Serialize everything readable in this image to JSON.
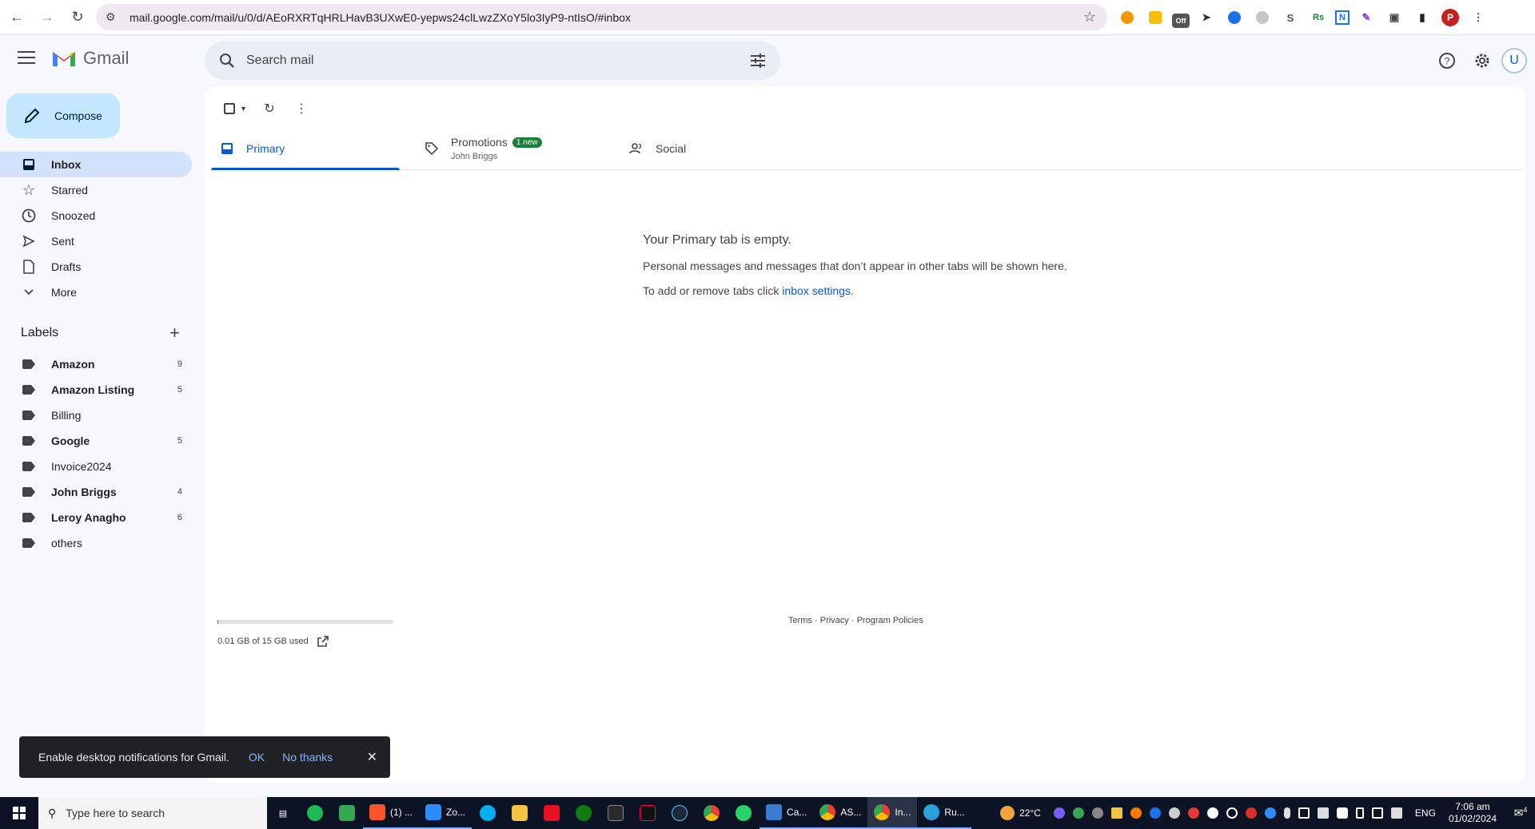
{
  "browser": {
    "url": "mail.google.com/mail/u/0/d/AEoRXRTqHRLHavB3UXwE0-yepws24clLwzZXoY5lo3IyP9-ntIsO/#inbox",
    "extension_badge": "Off",
    "profile_initial": "P"
  },
  "header": {
    "logo_text": "Gmail",
    "search_placeholder": "Search mail",
    "avatar_initial": "U"
  },
  "sidebar": {
    "compose_label": "Compose",
    "items": [
      {
        "label": "Inbox",
        "icon": "inbox-icon",
        "active": true
      },
      {
        "label": "Starred",
        "icon": "star-icon",
        "active": false
      },
      {
        "label": "Snoozed",
        "icon": "clock-icon",
        "active": false
      },
      {
        "label": "Sent",
        "icon": "send-icon",
        "active": false
      },
      {
        "label": "Drafts",
        "icon": "draft-icon",
        "active": false
      },
      {
        "label": "More",
        "icon": "chevron-down-icon",
        "active": false
      }
    ],
    "labels_title": "Labels",
    "labels": [
      {
        "label": "Amazon",
        "count": "9",
        "bold": true
      },
      {
        "label": "Amazon Listing",
        "count": "5",
        "bold": true
      },
      {
        "label": "Billing",
        "count": "",
        "bold": false
      },
      {
        "label": "Google",
        "count": "5",
        "bold": true
      },
      {
        "label": "Invoice2024",
        "count": "",
        "bold": false
      },
      {
        "label": "John Briggs",
        "count": "4",
        "bold": true
      },
      {
        "label": "Leroy Anagho",
        "count": "6",
        "bold": true
      },
      {
        "label": "others",
        "count": "",
        "bold": false
      }
    ]
  },
  "tabs": [
    {
      "name": "Primary",
      "sub": "",
      "badge": "",
      "active": true
    },
    {
      "name": "Promotions",
      "sub": "John Briggs",
      "badge": "1 new",
      "active": false
    },
    {
      "name": "Social",
      "sub": "",
      "badge": "",
      "active": false
    }
  ],
  "empty_state": {
    "heading": "Your Primary tab is empty.",
    "line1": "Personal messages and messages that don’t appear in other tabs will be shown here.",
    "line2_prefix": "To add or remove tabs click ",
    "line2_link": "inbox settings",
    "line2_suffix": "."
  },
  "storage": {
    "text": "0.01 GB of 15 GB used",
    "fraction": 0.001
  },
  "footer": {
    "terms": "Terms",
    "sep": " · ",
    "privacy": "Privacy",
    "policies": "Program Policies"
  },
  "snackbar": {
    "message": "Enable desktop notifications for Gmail.",
    "ok": "OK",
    "no_thanks": "No thanks"
  },
  "taskbar": {
    "search_placeholder": "Type here to search",
    "apps": [
      {
        "label": "(1) ...",
        "color": "#fb542b"
      },
      {
        "label": "Zo...",
        "color": "#2d8cff"
      },
      {
        "label": "Ca...",
        "color": "#3a7bd5"
      },
      {
        "label": "AS...",
        "color": "#34a853"
      },
      {
        "label": "In...",
        "color": "#ea4335"
      },
      {
        "label": "Ru...",
        "color": "#2aa1da"
      }
    ],
    "weather": "22°C",
    "language": "ENG",
    "time": "7:06 am",
    "date": "01/02/2024",
    "notification_count": "4"
  }
}
